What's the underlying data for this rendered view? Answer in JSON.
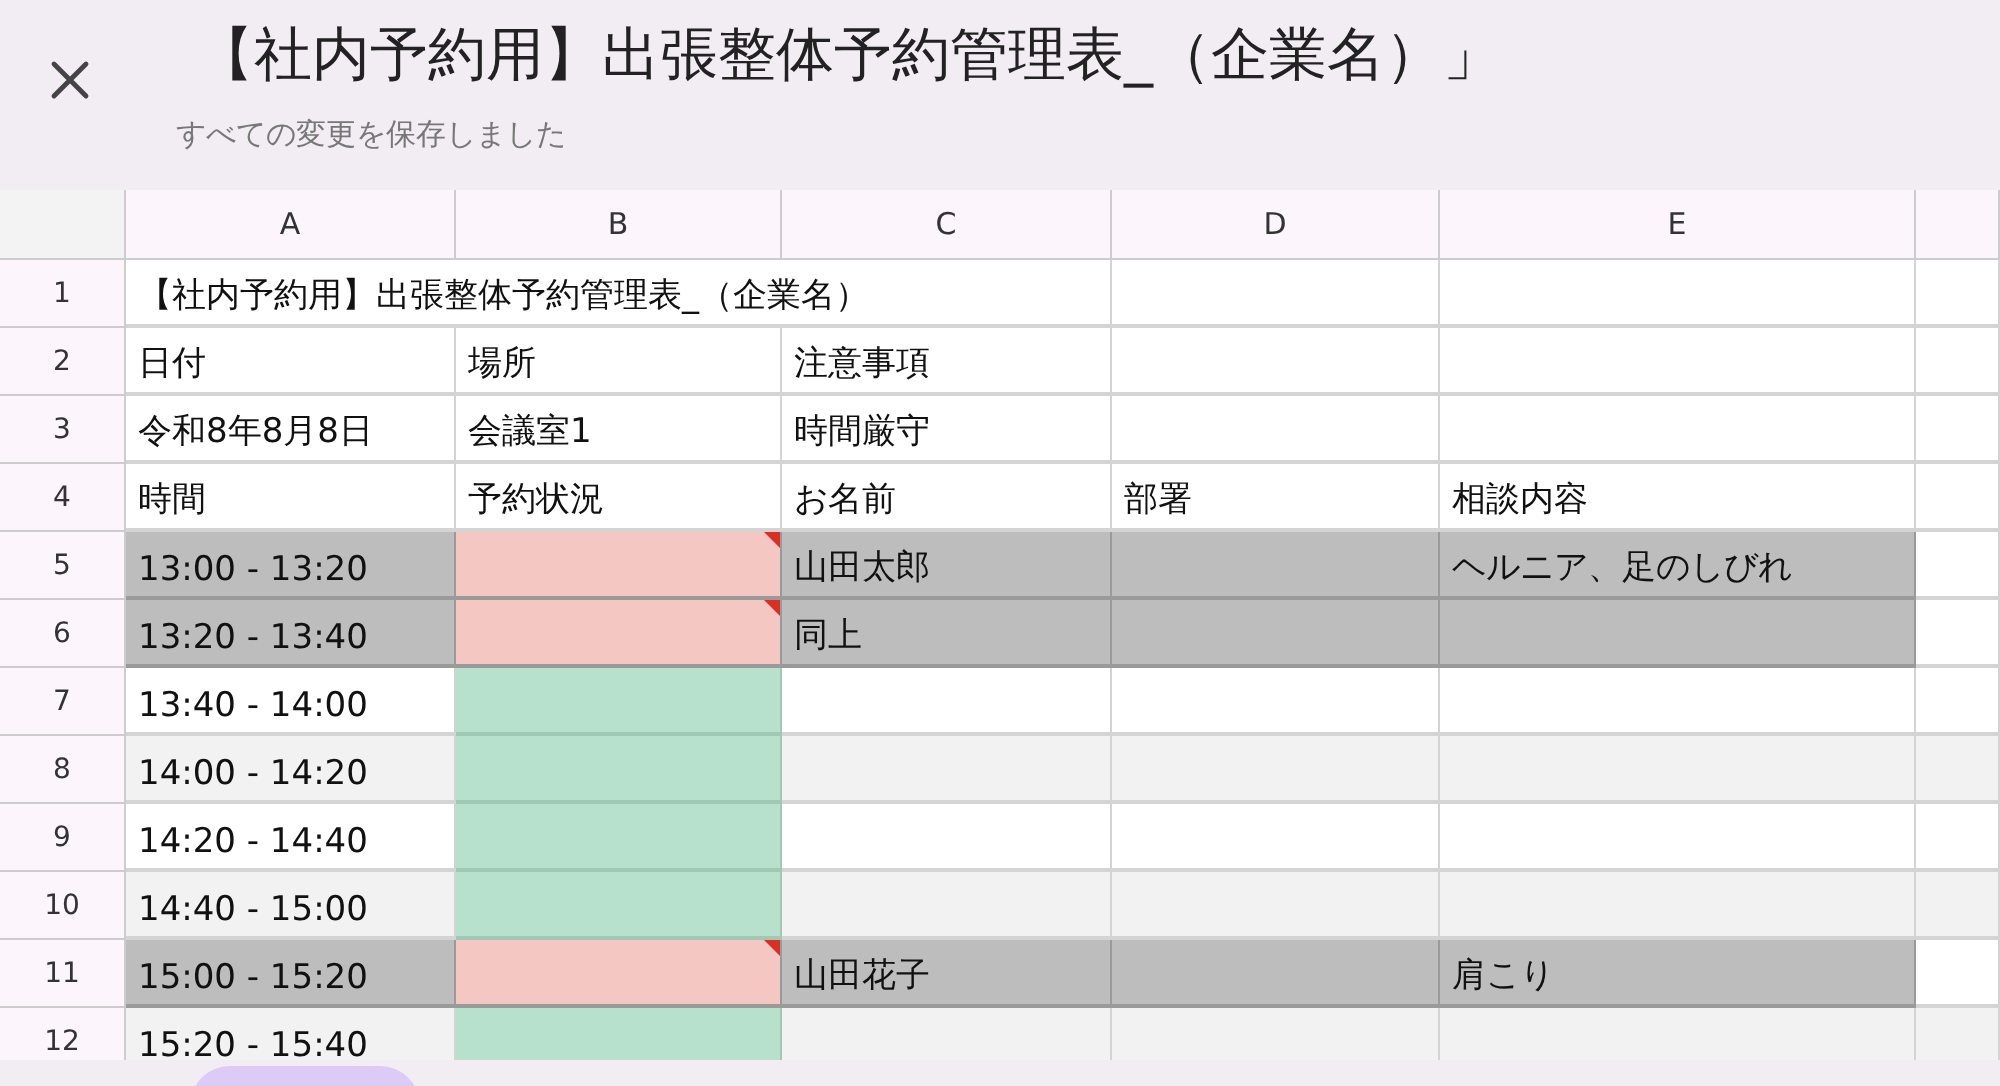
{
  "title": "【社内予約用】出張整体予約管理表_（企業名）」",
  "save_status": "すべての変更を保存しました",
  "columns": [
    "A",
    "B",
    "C",
    "D",
    "E"
  ],
  "rows": [
    {
      "number": "1",
      "cells": {
        "A": "【社内予約用】出張整体予約管理表_（企業名）"
      }
    },
    {
      "number": "2",
      "cells": {
        "A": "日付",
        "B": "場所",
        "C": "注意事項"
      }
    },
    {
      "number": "3",
      "cells": {
        "A": "令和8年8月8日",
        "B": "会議室1",
        "C": "時間厳守"
      }
    },
    {
      "number": "4",
      "cells": {
        "A": "時間",
        "B": "予約状況",
        "C": "お名前",
        "D": "部署",
        "E": "相談内容"
      }
    },
    {
      "number": "5",
      "booked": true,
      "cells": {
        "A": "13:00 - 13:20",
        "C": "山田太郎",
        "E": "ヘルニア、足のしびれ"
      }
    },
    {
      "number": "6",
      "booked": true,
      "cells": {
        "A": "13:20 - 13:40",
        "C": "同上"
      }
    },
    {
      "number": "7",
      "booked": false,
      "cells": {
        "A": "13:40 - 14:00"
      }
    },
    {
      "number": "8",
      "booked": false,
      "cells": {
        "A": "14:00 - 14:20"
      }
    },
    {
      "number": "9",
      "booked": false,
      "cells": {
        "A": "14:20 - 14:40"
      }
    },
    {
      "number": "10",
      "booked": false,
      "cells": {
        "A": "14:40 - 15:00"
      }
    },
    {
      "number": "11",
      "booked": true,
      "cells": {
        "A": "15:00 - 15:20",
        "C": "山田花子",
        "E": "肩こり"
      }
    },
    {
      "number": "12",
      "booked": false,
      "cells": {
        "A": "15:20 - 15:40"
      }
    }
  ]
}
